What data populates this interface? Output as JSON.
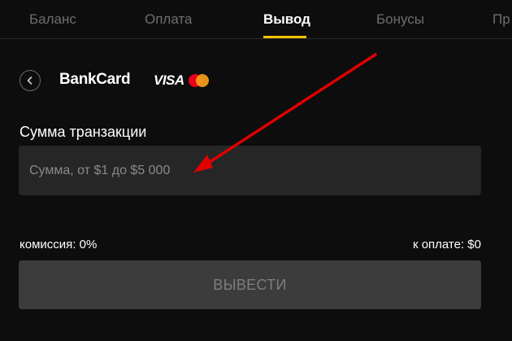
{
  "tabs": [
    {
      "label": "Баланс",
      "active": false
    },
    {
      "label": "Оплата",
      "active": false
    },
    {
      "label": "Вывод",
      "active": true
    },
    {
      "label": "Бонусы",
      "active": false
    },
    {
      "label": "Пр",
      "active": false
    }
  ],
  "header": {
    "back_icon": "chevron-left-icon",
    "method_title": "BankCard",
    "visa_text": "VISA",
    "mastercard_icon": "mastercard-logo"
  },
  "form": {
    "amount_label": "Сумма транзакции",
    "amount_value": "",
    "amount_placeholder": "Сумма, от $1 до $5 000"
  },
  "summary": {
    "commission": "комиссия: 0%",
    "to_pay": "к оплате: $0"
  },
  "submit": {
    "label": "ВЫВЕСТИ"
  },
  "colors": {
    "background": "#0d0d0d",
    "accent": "#f2c200",
    "input_bg": "#262626",
    "button_disabled_bg": "#3c3c3c",
    "annotation_arrow": "#e00000"
  }
}
